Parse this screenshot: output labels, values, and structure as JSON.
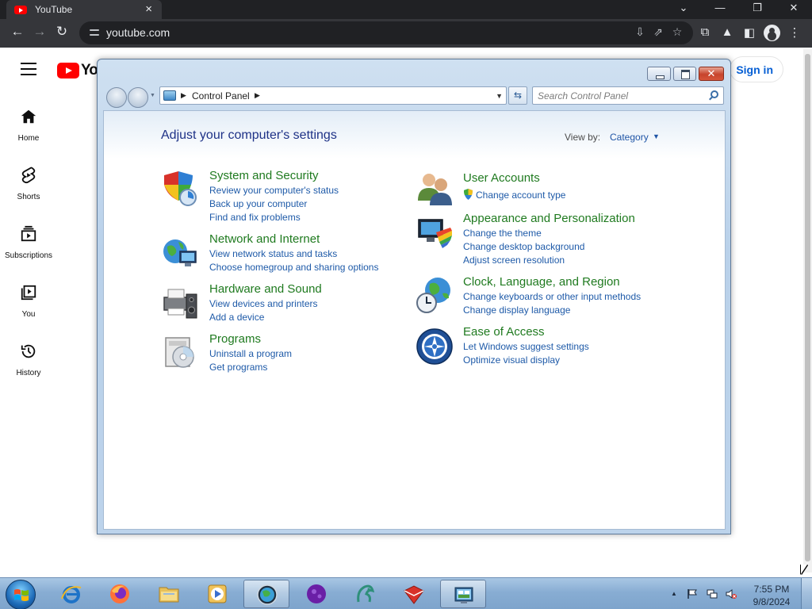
{
  "browser": {
    "tab_title": "YouTube",
    "tab_close": "×",
    "address_url": "youtube.com",
    "window_minimize": "—",
    "window_restore": "❐",
    "window_close": "✕",
    "tab_search": "⌄"
  },
  "youtube": {
    "logo_text": "Yo",
    "sign_in": "Sign in",
    "sidebar": [
      {
        "label": "Home",
        "icon": "home-icon"
      },
      {
        "label": "Shorts",
        "icon": "shorts-icon"
      },
      {
        "label": "Subscriptions",
        "icon": "subscriptions-icon"
      },
      {
        "label": "You",
        "icon": "you-icon"
      },
      {
        "label": "History",
        "icon": "history-icon"
      }
    ]
  },
  "control_panel": {
    "breadcrumb": "Control Panel",
    "search_placeholder": "Search Control Panel",
    "heading": "Adjust your computer's settings",
    "view_by_label": "View by:",
    "view_by_value": "Category",
    "categories": [
      {
        "title": "System and Security",
        "icon": "shield-icon",
        "links": [
          "Review your computer's status",
          "Back up your computer",
          "Find and fix problems"
        ]
      },
      {
        "title": "Network and Internet",
        "icon": "network-globe-icon",
        "links": [
          "View network status and tasks",
          "Choose homegroup and sharing options"
        ]
      },
      {
        "title": "Hardware and Sound",
        "icon": "printer-speaker-icon",
        "links": [
          "View devices and printers",
          "Add a device"
        ]
      },
      {
        "title": "Programs",
        "icon": "programs-disc-icon",
        "links": [
          "Uninstall a program",
          "Get programs"
        ]
      },
      {
        "title": "User Accounts",
        "icon": "users-icon",
        "links": [
          "Change account type"
        ]
      },
      {
        "title": "Appearance and Personalization",
        "icon": "monitor-palette-icon",
        "links": [
          "Change the theme",
          "Change desktop background",
          "Adjust screen resolution"
        ]
      },
      {
        "title": "Clock, Language, and Region",
        "icon": "clock-globe-icon",
        "links": [
          "Change keyboards or other input methods",
          "Change display language"
        ]
      },
      {
        "title": "Ease of Access",
        "icon": "ease-of-access-icon",
        "links": [
          "Let Windows suggest settings",
          "Optimize visual display"
        ]
      }
    ]
  },
  "taskbar": {
    "time": "7:55 PM",
    "date": "9/8/2024"
  },
  "colors": {
    "category_title": "#1f7a1f",
    "category_link": "#1e5aa8",
    "heading": "#1e3287",
    "youtube_red": "#ff0000",
    "sign_in_blue": "#065fd4"
  }
}
